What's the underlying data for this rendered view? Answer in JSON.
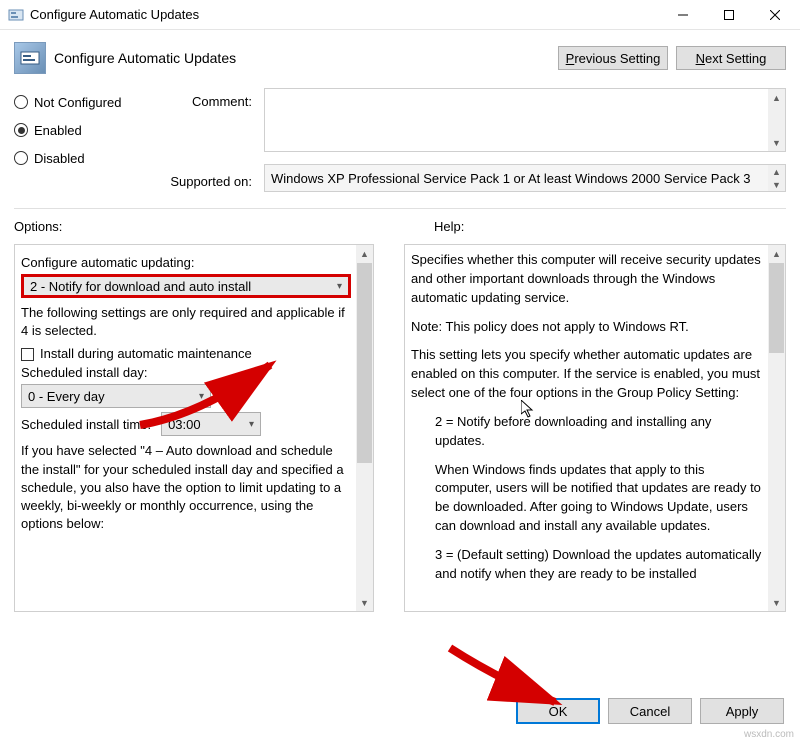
{
  "window": {
    "title": "Configure Automatic Updates"
  },
  "header": {
    "title": "Configure Automatic Updates",
    "prev_label": "Previous Setting",
    "next_label": "Next Setting"
  },
  "states": {
    "not_configured": "Not Configured",
    "enabled": "Enabled",
    "disabled": "Disabled",
    "selected": "enabled"
  },
  "comment": {
    "label": "Comment:",
    "value": ""
  },
  "supported": {
    "label": "Supported on:",
    "value": "Windows XP Professional Service Pack 1 or At least Windows 2000 Service Pack 3"
  },
  "panels": {
    "options_label": "Options:",
    "help_label": "Help:"
  },
  "options": {
    "configure_label": "Configure automatic updating:",
    "configure_value": "2 - Notify for download and auto install",
    "following_note": "The following settings are only required and applicable if 4 is selected.",
    "maintenance_chk_label": "Install during automatic maintenance",
    "day_label": "Scheduled install day:",
    "day_value": "0 - Every day",
    "time_label": "Scheduled install time:",
    "time_value": "03:00",
    "occurrence_note": "If you have selected \"4 – Auto download and schedule the install\" for your scheduled install day and specified a schedule, you also have the option to limit updating to a weekly, bi-weekly or monthly occurrence, using the options below:"
  },
  "help": {
    "p1": "Specifies whether this computer will receive security updates and other important downloads through the Windows automatic updating service.",
    "p2": "Note: This policy does not apply to Windows RT.",
    "p3": "This setting lets you specify whether automatic updates are enabled on this computer. If the service is enabled, you must select one of the four options in the Group Policy Setting:",
    "p4": "2 = Notify before downloading and installing any updates.",
    "p5": "When Windows finds updates that apply to this computer, users will be notified that updates are ready to be downloaded. After going to Windows Update, users can download and install any available updates.",
    "p6": "3 = (Default setting) Download the updates automatically and notify when they are ready to be installed"
  },
  "footer": {
    "ok": "OK",
    "cancel": "Cancel",
    "apply": "Apply"
  },
  "watermark": "wsxdn.com"
}
